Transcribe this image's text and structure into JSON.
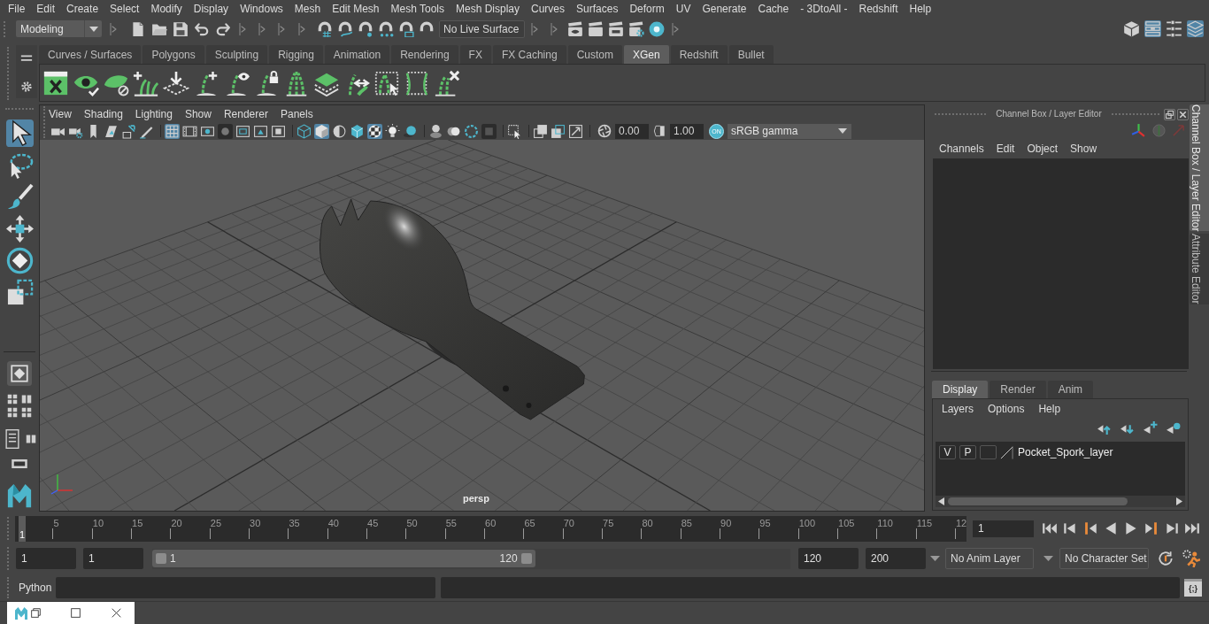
{
  "menu_bar": [
    "File",
    "Edit",
    "Create",
    "Select",
    "Modify",
    "Display",
    "Windows",
    "Mesh",
    "Edit Mesh",
    "Mesh Tools",
    "Mesh Display",
    "Curves",
    "Surfaces",
    "Deform",
    "UV",
    "Generate",
    "Cache",
    "- 3DtoAll -",
    "Redshift",
    "Help"
  ],
  "status_line": {
    "workspace": "Modeling",
    "live_surface": "No Live Surface",
    "panel_toggles": [
      {
        "on": false
      },
      {
        "on": true
      },
      {
        "on": false
      },
      {
        "on": true
      }
    ]
  },
  "shelf": {
    "tabs": [
      {
        "label": "Curves / Surfaces",
        "selected": false
      },
      {
        "label": "Polygons",
        "selected": false
      },
      {
        "label": "Sculpting",
        "selected": false
      },
      {
        "label": "Rigging",
        "selected": false
      },
      {
        "label": "Animation",
        "selected": false
      },
      {
        "label": "Rendering",
        "selected": false
      },
      {
        "label": "FX",
        "selected": false
      },
      {
        "label": "FX Caching",
        "selected": false
      },
      {
        "label": "Custom",
        "selected": false
      },
      {
        "label": "XGen",
        "selected": true
      },
      {
        "label": "Redshift",
        "selected": false
      },
      {
        "label": "Bullet",
        "selected": false
      }
    ]
  },
  "toolbox": [
    {
      "selected": true
    },
    {
      "selected": false
    },
    {
      "selected": false
    },
    {
      "selected": false
    },
    {
      "selected": false
    },
    {
      "selected": false
    }
  ],
  "viewport": {
    "menus": [
      "View",
      "Shading",
      "Lighting",
      "Show",
      "Renderer",
      "Panels"
    ],
    "toolbar": [
      {
        "on": false
      },
      {
        "on": false
      },
      {
        "on": false
      },
      {
        "on": false
      },
      {
        "on": false
      },
      {
        "on": false
      },
      {
        "on": true
      },
      {
        "on": false
      },
      {
        "on": false
      },
      {
        "on": false
      },
      {
        "on": false
      },
      {
        "on": false
      },
      {
        "on": false
      },
      {
        "on": false
      },
      {
        "on": true
      },
      {
        "on": false
      },
      {
        "on": false
      },
      {
        "on": true
      },
      {
        "on": false
      },
      {
        "on": false
      },
      {
        "on": false
      },
      {
        "on": false
      },
      {
        "on": false
      },
      {
        "on": false
      },
      {
        "on": false
      },
      {
        "on": false
      },
      {
        "on": false
      },
      {
        "on": false
      }
    ],
    "exposure": "0.00",
    "gamma": "1.00",
    "color_management": "ON",
    "color_space": "sRGB gamma",
    "camera": "persp"
  },
  "channel_box": {
    "title": "Channel Box / Layer Editor",
    "menus": [
      "Channels",
      "Edit",
      "Object",
      "Show"
    ],
    "layer_tabs": [
      {
        "label": "Display",
        "selected": true
      },
      {
        "label": "Render",
        "selected": false
      },
      {
        "label": "Anim",
        "selected": false
      }
    ],
    "layer_menus": [
      "Layers",
      "Options",
      "Help"
    ],
    "layers": [
      {
        "visibility": "V",
        "playback": "P",
        "name": "Pocket_Spork_layer"
      }
    ]
  },
  "side_tabs": [
    {
      "label": "Channel Box / Layer Editor",
      "selected": true
    },
    {
      "label": "Attribute Editor",
      "selected": false
    }
  ],
  "time_slider": {
    "ticks": [
      "5",
      "10",
      "15",
      "20",
      "25",
      "30",
      "35",
      "40",
      "45",
      "50",
      "55",
      "60",
      "65",
      "70",
      "75",
      "80",
      "85",
      "90",
      "95",
      "100",
      "105",
      "110",
      "115",
      "12"
    ],
    "current_time": "1",
    "current_frame": "1"
  },
  "range_slider": {
    "animation_start": "1",
    "playback_start": "1",
    "range_start": "1",
    "range_end": "120",
    "level": 0.6,
    "playback_end": "120",
    "animation_end": "200",
    "anim_layer": "No Anim Layer",
    "character_set": "No Character Set"
  },
  "command_line": {
    "language": "Python",
    "script_editor": "{;}"
  }
}
